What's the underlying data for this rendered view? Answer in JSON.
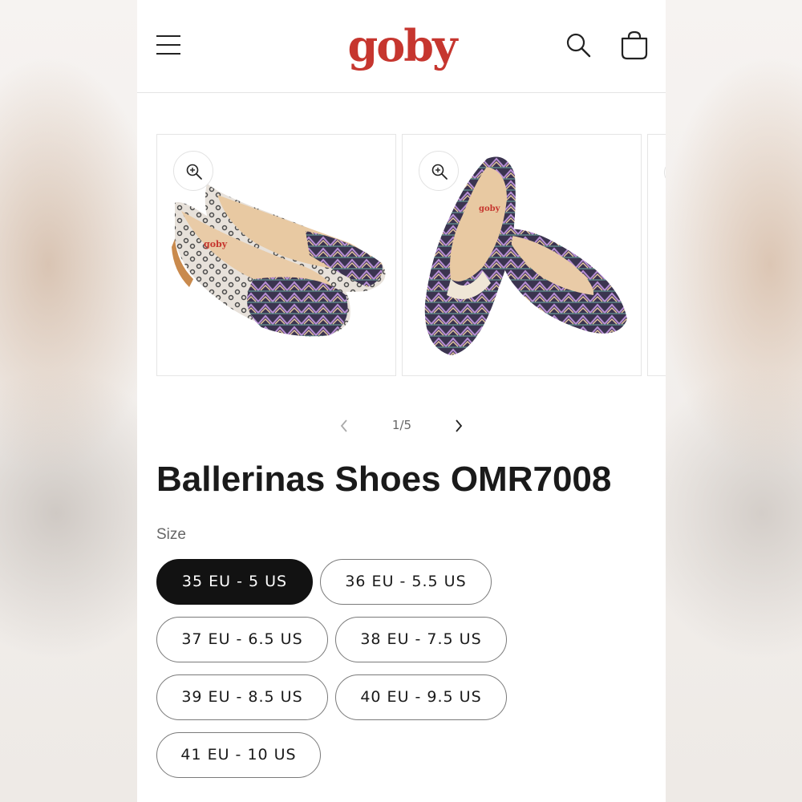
{
  "header": {
    "logo_text": "goby",
    "brand_color": "#c6362f",
    "icons": [
      "menu-icon",
      "search-icon",
      "cart-icon"
    ]
  },
  "gallery": {
    "slides": [
      {
        "image": "ballerina-shoes-pair-photo-front"
      },
      {
        "image": "ballerina-shoes-pair-photo-angle"
      },
      {
        "image": "ballerina-shoes-photo-partial"
      }
    ],
    "pager_text": "1/5"
  },
  "product": {
    "title": "Ballerinas Shoes OMR7008",
    "size_label": "Size",
    "sizes": [
      {
        "label": "35 EU - 5 US",
        "selected": true
      },
      {
        "label": "36 EU - 5.5 US",
        "selected": false
      },
      {
        "label": "37 EU - 6.5 US",
        "selected": false
      },
      {
        "label": "38 EU - 7.5 US",
        "selected": false
      },
      {
        "label": "39 EU - 8.5 US",
        "selected": false
      },
      {
        "label": "40 EU - 9.5 US",
        "selected": false
      },
      {
        "label": "41 EU - 10 US",
        "selected": false
      }
    ]
  }
}
